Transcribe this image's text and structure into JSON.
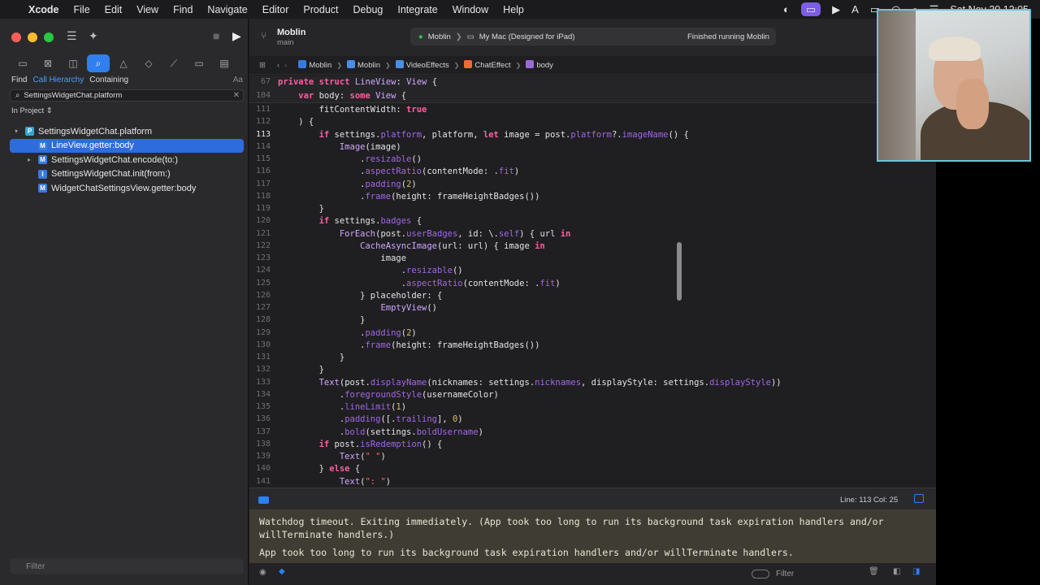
{
  "menubar": {
    "app": "Xcode",
    "items": [
      "File",
      "Edit",
      "View",
      "Find",
      "Navigate",
      "Editor",
      "Product",
      "Debug",
      "Integrate",
      "Window",
      "Help"
    ],
    "clock": "Sat Nov 30 12:05"
  },
  "toolbar": {
    "project": "Moblin",
    "branch": "main",
    "scheme": "Moblin",
    "destination": "My Mac (Designed for iPad)",
    "status": "Finished running Moblin"
  },
  "sidebar": {
    "find_label": "Find",
    "mode": "Call Hierarchy",
    "match": "Containing",
    "case_label": "Aa",
    "search_value": "SettingsWidgetChat.platform",
    "scope": "In Project",
    "tree": [
      {
        "label": "SettingsWidgetChat.platform",
        "badge": "P",
        "level": 0,
        "arrow": "▾"
      },
      {
        "label": "LineView.getter:body",
        "badge": "M",
        "level": 1,
        "arrow": ""
      },
      {
        "label": "SettingsWidgetChat.encode(to:)",
        "badge": "M",
        "level": 1,
        "arrow": "▸"
      },
      {
        "label": "SettingsWidgetChat.init(from:)",
        "badge": "I",
        "level": 1,
        "arrow": ""
      },
      {
        "label": "WidgetChatSettingsView.getter:body",
        "badge": "M",
        "level": 1,
        "arrow": ""
      }
    ],
    "filter_placeholder": "Filter"
  },
  "jumpbar": [
    "Moblin",
    "Moblin",
    "VideoEffects",
    "ChatEffect",
    "body"
  ],
  "editor": {
    "sticky": [
      {
        "n": "67",
        "code": "private struct LineView: View {"
      },
      {
        "n": "104",
        "code": "    var body: some View {"
      }
    ],
    "lines": [
      {
        "n": "111",
        "code": "        fitContentWidth: true"
      },
      {
        "n": "112",
        "code": "    ) {"
      },
      {
        "n": "113",
        "code": "        if settings.platform, platform, let image = post.platform?.imageName() {"
      },
      {
        "n": "114",
        "code": "            Image(image)"
      },
      {
        "n": "115",
        "code": "                .resizable()"
      },
      {
        "n": "116",
        "code": "                .aspectRatio(contentMode: .fit)"
      },
      {
        "n": "117",
        "code": "                .padding(2)"
      },
      {
        "n": "118",
        "code": "                .frame(height: frameHeightBadges())"
      },
      {
        "n": "119",
        "code": "        }"
      },
      {
        "n": "120",
        "code": "        if settings.badges {"
      },
      {
        "n": "121",
        "code": "            ForEach(post.userBadges, id: \\.self) { url in"
      },
      {
        "n": "122",
        "code": "                CacheAsyncImage(url: url) { image in"
      },
      {
        "n": "123",
        "code": "                    image"
      },
      {
        "n": "124",
        "code": "                        .resizable()"
      },
      {
        "n": "125",
        "code": "                        .aspectRatio(contentMode: .fit)"
      },
      {
        "n": "126",
        "code": "                } placeholder: {"
      },
      {
        "n": "127",
        "code": "                    EmptyView()"
      },
      {
        "n": "128",
        "code": "                }"
      },
      {
        "n": "129",
        "code": "                .padding(2)"
      },
      {
        "n": "130",
        "code": "                .frame(height: frameHeightBadges())"
      },
      {
        "n": "131",
        "code": "            }"
      },
      {
        "n": "132",
        "code": "        }"
      },
      {
        "n": "133",
        "code": "        Text(post.displayName(nicknames: settings.nicknames, displayStyle: settings.displayStyle))"
      },
      {
        "n": "134",
        "code": "            .foregroundStyle(usernameColor)"
      },
      {
        "n": "135",
        "code": "            .lineLimit(1)"
      },
      {
        "n": "136",
        "code": "            .padding([.trailing], 0)"
      },
      {
        "n": "137",
        "code": "            .bold(settings.boldUsername)"
      },
      {
        "n": "138",
        "code": "        if post.isRedemption() {"
      },
      {
        "n": "139",
        "code": "            Text(\" \")"
      },
      {
        "n": "140",
        "code": "        } else {"
      },
      {
        "n": "141",
        "code": "            Text(\": \")"
      }
    ],
    "current_line": "113"
  },
  "debugbar": {
    "position": "Line: 113  Col: 25"
  },
  "console": {
    "messages": [
      "Watchdog timeout. Exiting immediately. (App took too long to run its background task expiration handlers and/or willTerminate handlers.)",
      "App took too long to run its background task expiration handlers and/or willTerminate handlers."
    ],
    "filter_placeholder": "Filter"
  },
  "icons": {
    "apple": "apple-logo-icon",
    "colors": {
      "accent": "#2e7ff0",
      "keyword": "#fc5fa3",
      "type": "#d0a8ff",
      "number": "#d0bf69"
    }
  }
}
